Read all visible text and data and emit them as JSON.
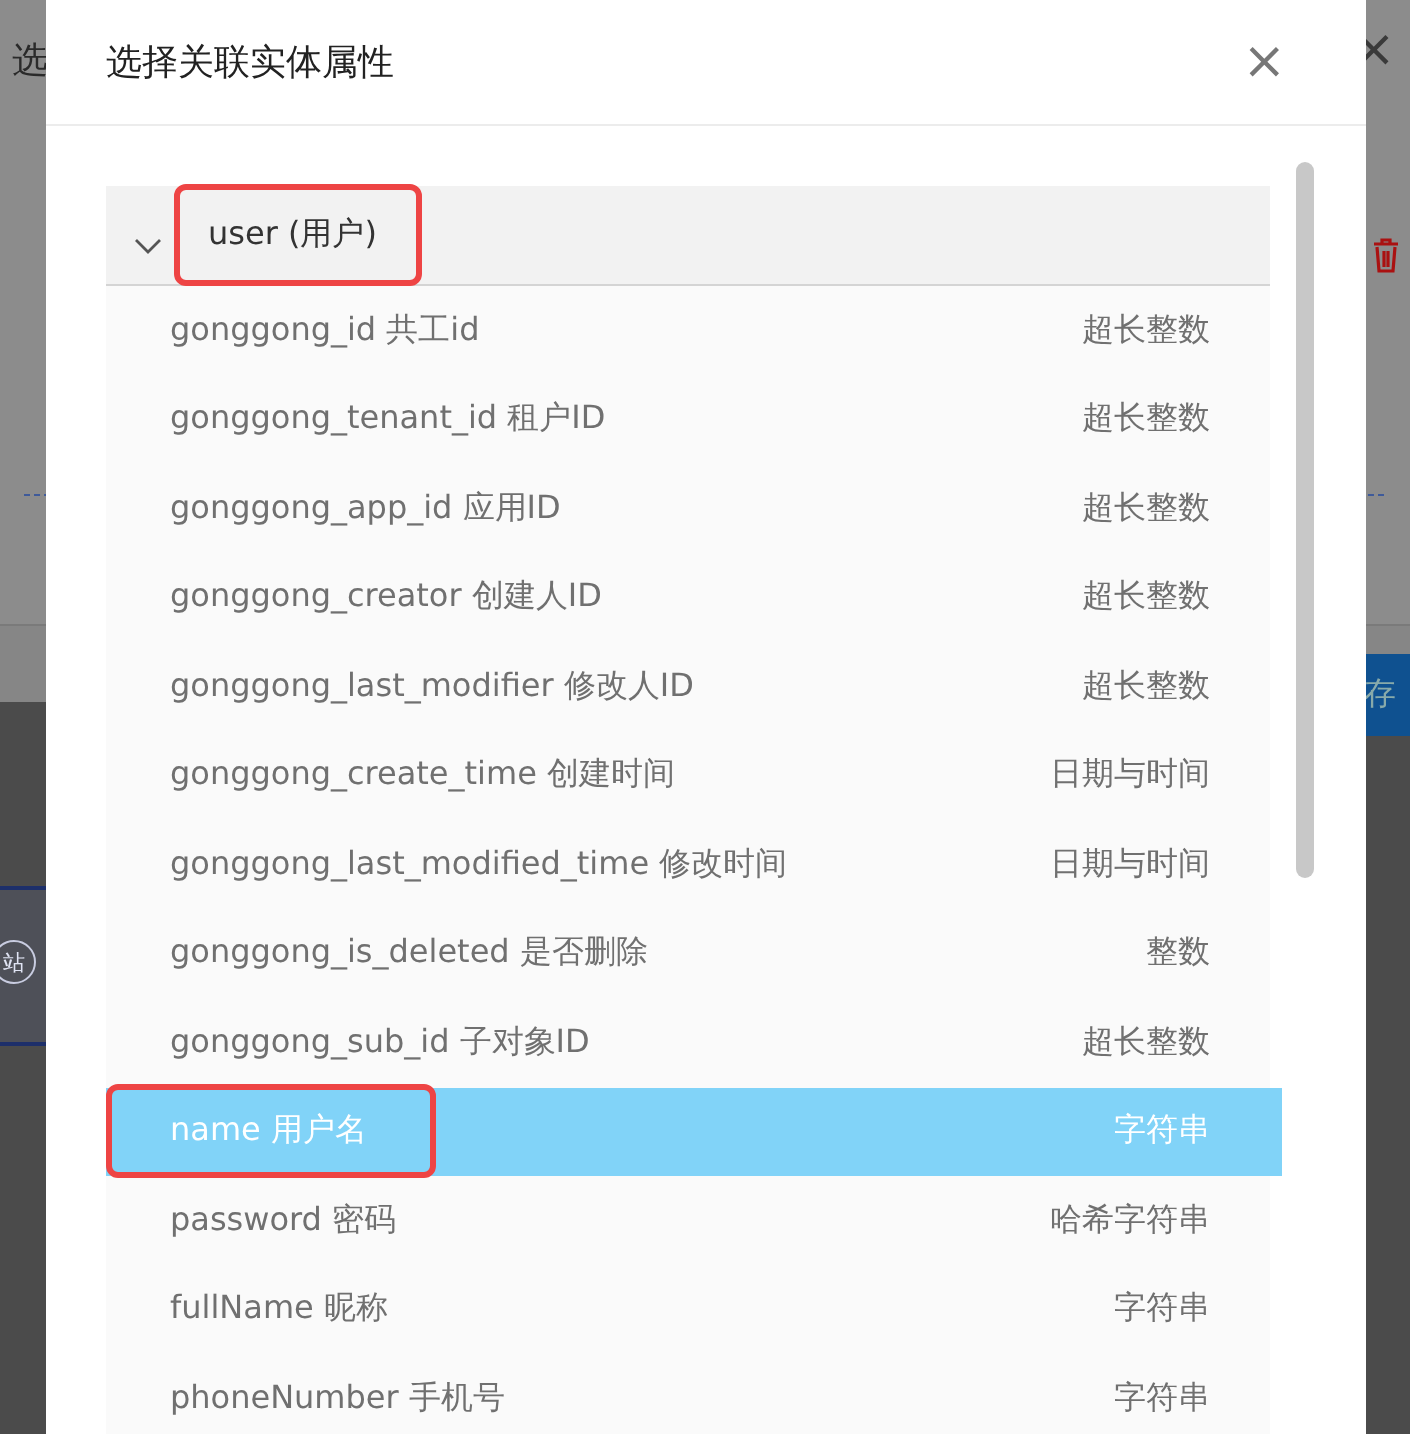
{
  "background": {
    "title_fragment": "选",
    "save_fragment": "存",
    "site_fragment": "站"
  },
  "dialog": {
    "title": "选择关联实体属性",
    "close": "×"
  },
  "group": {
    "label": "user (用户)",
    "expanded": true,
    "highlighted": true,
    "fields": [
      {
        "name": "gonggong_id 共工id",
        "type": "超长整数",
        "selected": false,
        "highlighted": false
      },
      {
        "name": "gonggong_tenant_id 租户ID",
        "type": "超长整数",
        "selected": false,
        "highlighted": false
      },
      {
        "name": "gonggong_app_id 应用ID",
        "type": "超长整数",
        "selected": false,
        "highlighted": false
      },
      {
        "name": "gonggong_creator 创建人ID",
        "type": "超长整数",
        "selected": false,
        "highlighted": false
      },
      {
        "name": "gonggong_last_modifier 修改人ID",
        "type": "超长整数",
        "selected": false,
        "highlighted": false
      },
      {
        "name": "gonggong_create_time 创建时间",
        "type": "日期与时间",
        "selected": false,
        "highlighted": false
      },
      {
        "name": "gonggong_last_modified_time 修改时间",
        "type": "日期与时间",
        "selected": false,
        "highlighted": false
      },
      {
        "name": "gonggong_is_deleted 是否删除",
        "type": "整数",
        "selected": false,
        "highlighted": false
      },
      {
        "name": "gonggong_sub_id 子对象ID",
        "type": "超长整数",
        "selected": false,
        "highlighted": false
      },
      {
        "name": "name 用户名",
        "type": "字符串",
        "selected": true,
        "highlighted": true
      },
      {
        "name": "password 密码",
        "type": "哈希字符串",
        "selected": false,
        "highlighted": false
      },
      {
        "name": "fullName 昵称",
        "type": "字符串",
        "selected": false,
        "highlighted": false
      },
      {
        "name": "phoneNumber 手机号",
        "type": "字符串",
        "selected": false,
        "highlighted": false
      }
    ]
  }
}
